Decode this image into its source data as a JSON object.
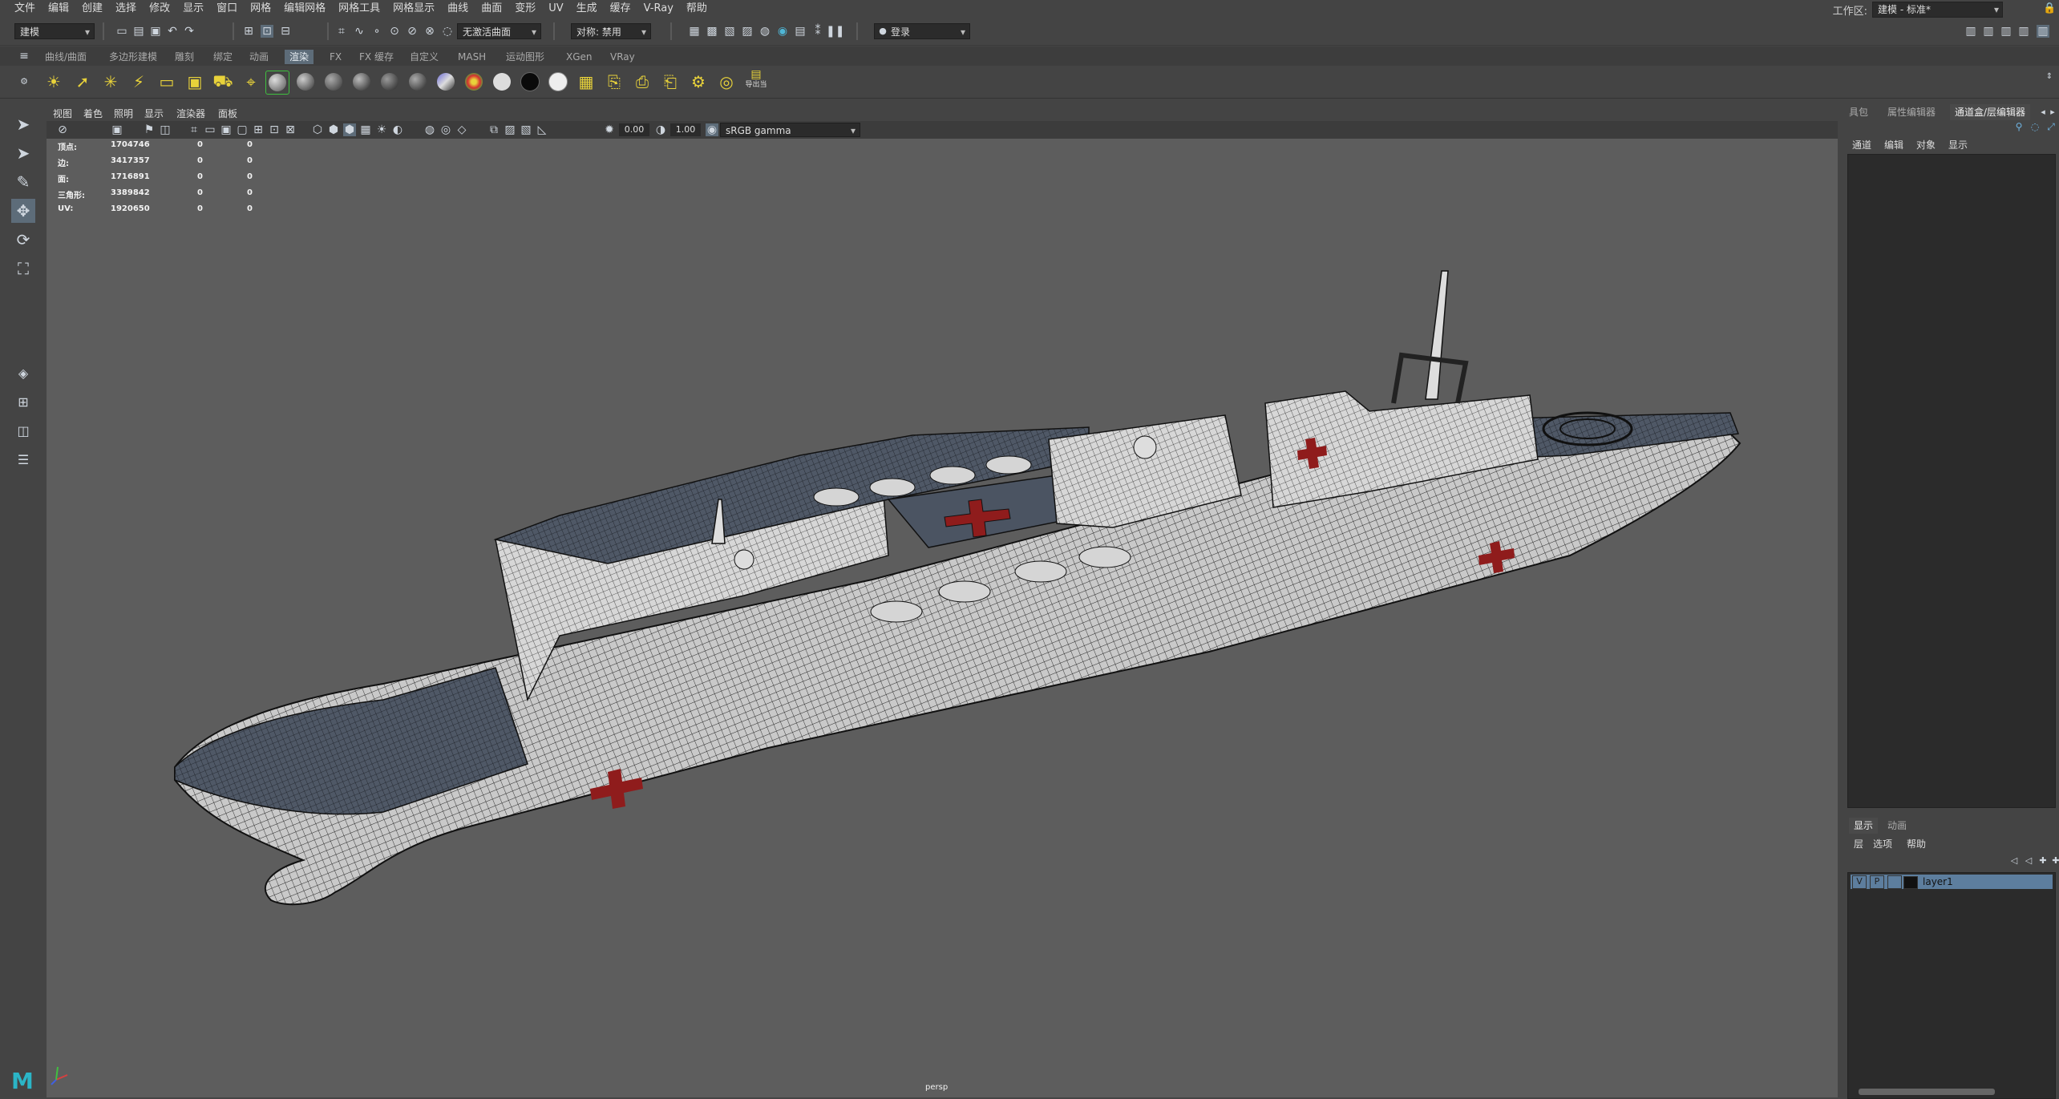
{
  "menubar": {
    "items": [
      "文件",
      "编辑",
      "创建",
      "选择",
      "修改",
      "显示",
      "窗口",
      "网格",
      "编辑网格",
      "网格工具",
      "网格显示",
      "曲线",
      "曲面",
      "变形",
      "UV",
      "生成",
      "缓存",
      "V-Ray",
      "帮助"
    ],
    "workspace_label": "工作区:",
    "workspace_value": "建模 - 标准*"
  },
  "statusline": {
    "mode_menu": "建模",
    "live_surface": "无激活曲面",
    "symmetry": "对称: 禁用",
    "login": "登录"
  },
  "shelf": {
    "tabs": [
      "曲线/曲面",
      "多边形建模",
      "雕刻",
      "绑定",
      "动画",
      "渲染",
      "FX",
      "FX 缓存",
      "自定义",
      "MASH",
      "运动图形",
      "XGen",
      "VRay"
    ],
    "active_tab": "渲染",
    "export_label": "导出当"
  },
  "viewport": {
    "menu": [
      "视图",
      "着色",
      "照明",
      "显示",
      "渲染器",
      "面板"
    ],
    "exposure": "0.00",
    "gamma": "1.00",
    "colorspace": "sRGB gamma",
    "camera": "persp",
    "hud": [
      {
        "label": "顶点:",
        "total": "1704746",
        "sel1": "0",
        "sel2": "0"
      },
      {
        "label": "边:",
        "total": "3417357",
        "sel1": "0",
        "sel2": "0"
      },
      {
        "label": "面:",
        "total": "1716891",
        "sel1": "0",
        "sel2": "0"
      },
      {
        "label": "三角形:",
        "total": "3389842",
        "sel1": "0",
        "sel2": "0"
      },
      {
        "label": "UV:",
        "total": "1920650",
        "sel1": "0",
        "sel2": "0"
      }
    ]
  },
  "channelbox": {
    "tabs": [
      "建模工具包",
      "属性编辑器",
      "通道盒/层编辑器"
    ],
    "tab_short": "具包",
    "menu": [
      "通道",
      "编辑",
      "对象",
      "显示"
    ]
  },
  "layer_editor": {
    "tabs": [
      "显示",
      "动画"
    ],
    "menu": [
      "层",
      "选项",
      "帮助"
    ],
    "layer": {
      "v": "V",
      "p": "P",
      "name": "layer1"
    }
  },
  "colors": {
    "accent": "#5d6c79",
    "viewport_bg": "#5d5d5d",
    "cross_red": "#8f1c1c"
  },
  "icons": [
    "select-icon",
    "lasso-icon",
    "paint-select-icon",
    "move-icon",
    "rotate-icon",
    "scale-icon",
    "maya-logo-icon",
    "axis-gizmo-icon"
  ]
}
